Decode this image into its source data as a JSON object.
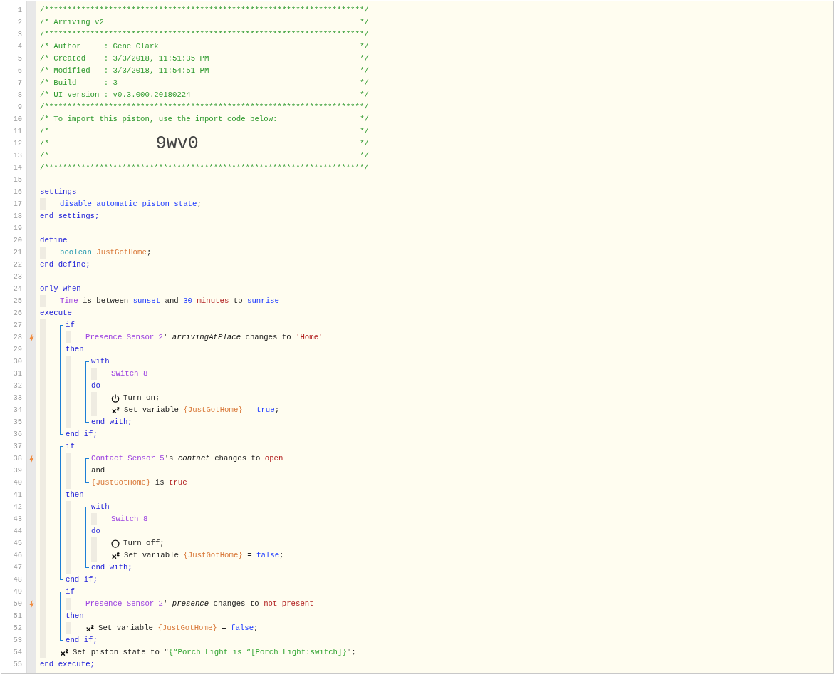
{
  "lines": [
    {
      "kind": "line",
      "number": "1",
      "trigger": false,
      "tokens": [
        {
          "kind": "comment",
          "text": "/**********************************************************************/"
        }
      ]
    },
    {
      "kind": "line",
      "number": "2",
      "trigger": false,
      "tokens": [
        {
          "kind": "comment",
          "text": "/* Arriving v2"
        }
      ],
      "tail": "*/"
    },
    {
      "kind": "line",
      "number": "3",
      "trigger": false,
      "tokens": [
        {
          "kind": "comment",
          "text": "/**********************************************************************/"
        }
      ]
    },
    {
      "kind": "line",
      "number": "4",
      "trigger": false,
      "tokens": [
        {
          "kind": "comment",
          "text": "/* Author     : Gene Clark"
        }
      ],
      "tail": "*/"
    },
    {
      "kind": "line",
      "number": "5",
      "trigger": false,
      "tokens": [
        {
          "kind": "comment",
          "text": "/* Created    : 3/3/2018, 11:51:35 PM"
        }
      ],
      "tail": "*/"
    },
    {
      "kind": "line",
      "number": "6",
      "trigger": false,
      "tokens": [
        {
          "kind": "comment",
          "text": "/* Modified   : 3/3/2018, 11:54:51 PM"
        }
      ],
      "tail": "*/"
    },
    {
      "kind": "line",
      "number": "7",
      "trigger": false,
      "tokens": [
        {
          "kind": "comment",
          "text": "/* Build      : 3"
        }
      ],
      "tail": "*/"
    },
    {
      "kind": "line",
      "number": "8",
      "trigger": false,
      "tokens": [
        {
          "kind": "comment",
          "text": "/* UI version : v0.3.000.20180224"
        }
      ],
      "tail": "*/"
    },
    {
      "kind": "line",
      "number": "9",
      "trigger": false,
      "tokens": [
        {
          "kind": "comment",
          "text": "/**********************************************************************/"
        }
      ]
    },
    {
      "kind": "line",
      "number": "10",
      "trigger": false,
      "tokens": [
        {
          "kind": "comment",
          "text": "/* To import this piston, use the import code below:"
        }
      ],
      "tail": "*/"
    },
    {
      "kind": "line",
      "number": "11",
      "trigger": false,
      "tokens": [
        {
          "kind": "comment",
          "text": "/*"
        }
      ],
      "tail": "*/"
    },
    {
      "kind": "line",
      "number": "12",
      "trigger": false,
      "tokens": [
        {
          "kind": "comment",
          "text": "/*"
        },
        {
          "kind": "code",
          "text": "9wv0"
        }
      ],
      "tail": "*/"
    },
    {
      "kind": "line",
      "number": "13",
      "trigger": false,
      "tokens": [
        {
          "kind": "comment",
          "text": "/*"
        }
      ],
      "tail": "*/"
    },
    {
      "kind": "line",
      "number": "14",
      "trigger": false,
      "tokens": [
        {
          "kind": "comment",
          "text": "/**********************************************************************/"
        }
      ]
    },
    {
      "kind": "line",
      "number": "15",
      "trigger": false
    },
    {
      "kind": "line",
      "number": "16",
      "trigger": false,
      "tokens": [
        {
          "kind": "keyword",
          "text": "settings"
        }
      ],
      "children": [
        {
          "kind": "line",
          "number": "17",
          "trigger": false,
          "tokens": [
            {
              "kind": "literal",
              "text": "disable automatic piston state"
            },
            {
              "kind": "plain",
              "text": ";"
            }
          ]
        }
      ]
    },
    {
      "kind": "line",
      "number": "18",
      "trigger": false,
      "tokens": [
        {
          "kind": "keyword",
          "text": "end settings;"
        }
      ]
    },
    {
      "kind": "line",
      "number": "19",
      "trigger": false
    },
    {
      "kind": "line",
      "number": "20",
      "trigger": false,
      "tokens": [
        {
          "kind": "keyword",
          "text": "define"
        }
      ],
      "children": [
        {
          "kind": "line",
          "number": "21",
          "trigger": false,
          "tokens": [
            {
              "kind": "type",
              "text": "boolean "
            },
            {
              "kind": "variable",
              "text": "JustGotHome"
            },
            {
              "kind": "plain",
              "text": ";"
            }
          ]
        }
      ]
    },
    {
      "kind": "line",
      "number": "22",
      "trigger": false,
      "tokens": [
        {
          "kind": "keyword",
          "text": "end define;"
        }
      ]
    },
    {
      "kind": "line",
      "number": "23",
      "trigger": false
    },
    {
      "kind": "line",
      "number": "24",
      "trigger": false,
      "tokens": [
        {
          "kind": "keyword",
          "text": "only when"
        }
      ],
      "children": [
        {
          "kind": "line",
          "number": "25",
          "trigger": false,
          "tokens": [
            {
              "kind": "device",
              "text": "Time"
            },
            {
              "kind": "plain",
              "text": " is between "
            },
            {
              "kind": "literal",
              "text": "sunset"
            },
            {
              "kind": "plain",
              "text": " and "
            },
            {
              "kind": "literal",
              "text": "30"
            },
            {
              "kind": "value",
              "text": " minutes"
            },
            {
              "kind": "plain",
              "text": " to "
            },
            {
              "kind": "literal",
              "text": "sunrise"
            }
          ]
        }
      ]
    },
    {
      "kind": "line",
      "number": "26",
      "trigger": false,
      "tokens": [
        {
          "kind": "keyword",
          "text": "execute"
        }
      ],
      "children": [
        {
          "kind": "group",
          "items": [
            {
              "kind": "line",
              "number": "27",
              "trigger": false,
              "tokens": [
                {
                  "kind": "keyword",
                  "text": "if"
                }
              ],
              "children": [
                {
                  "kind": "line",
                  "number": "28",
                  "trigger": true,
                  "tokens": [
                    {
                      "kind": "device",
                      "text": "Presence Sensor 2"
                    },
                    {
                      "kind": "plain",
                      "text": "' "
                    },
                    {
                      "kind": "attribute",
                      "text": "arrivingAtPlace"
                    },
                    {
                      "kind": "plain",
                      "text": " changes to "
                    },
                    {
                      "kind": "value",
                      "text": "'Home'"
                    }
                  ]
                }
              ]
            },
            {
              "kind": "line",
              "number": "29",
              "trigger": false,
              "tokens": [
                {
                  "kind": "keyword",
                  "text": "then"
                }
              ],
              "children": [
                {
                  "kind": "group",
                  "items": [
                    {
                      "kind": "line",
                      "number": "30",
                      "trigger": false,
                      "tokens": [
                        {
                          "kind": "keyword",
                          "text": "with"
                        }
                      ],
                      "children": [
                        {
                          "kind": "line",
                          "number": "31",
                          "trigger": false,
                          "tokens": [
                            {
                              "kind": "device",
                              "text": "Switch 8"
                            }
                          ]
                        }
                      ]
                    },
                    {
                      "kind": "line",
                      "number": "32",
                      "trigger": false,
                      "tokens": [
                        {
                          "kind": "keyword",
                          "text": "do"
                        }
                      ],
                      "children": [
                        {
                          "kind": "line",
                          "number": "33",
                          "trigger": false,
                          "tokens": [
                            {
                              "kind": "power"
                            },
                            {
                              "kind": "plain",
                              "text": "Turn on;"
                            }
                          ]
                        },
                        {
                          "kind": "line",
                          "number": "34",
                          "trigger": false,
                          "tokens": [
                            {
                              "kind": "superscript"
                            },
                            {
                              "kind": "plain",
                              "text": "Set variable "
                            },
                            {
                              "kind": "variable",
                              "text": "{JustGotHome}"
                            },
                            {
                              "kind": "plain",
                              "text": " = "
                            },
                            {
                              "kind": "literal",
                              "text": "true"
                            },
                            {
                              "kind": "plain",
                              "text": ";"
                            }
                          ]
                        }
                      ]
                    },
                    {
                      "kind": "line",
                      "number": "35",
                      "trigger": false,
                      "tokens": [
                        {
                          "kind": "keyword",
                          "text": "end with;"
                        }
                      ]
                    }
                  ]
                }
              ]
            },
            {
              "kind": "line",
              "number": "36",
              "trigger": false,
              "tokens": [
                {
                  "kind": "keyword",
                  "text": "end if;"
                }
              ]
            }
          ]
        },
        {
          "kind": "group",
          "items": [
            {
              "kind": "line",
              "number": "37",
              "trigger": false,
              "tokens": [
                {
                  "kind": "keyword",
                  "text": "if"
                }
              ],
              "children": [
                {
                  "kind": "group",
                  "items": [
                    {
                      "kind": "line",
                      "number": "38",
                      "trigger": true,
                      "tokens": [
                        {
                          "kind": "device",
                          "text": "Contact Sensor 5"
                        },
                        {
                          "kind": "plain",
                          "text": "'s "
                        },
                        {
                          "kind": "attribute",
                          "text": "contact"
                        },
                        {
                          "kind": "plain",
                          "text": " changes to "
                        },
                        {
                          "kind": "value",
                          "text": "open"
                        }
                      ]
                    },
                    {
                      "kind": "line",
                      "number": "39",
                      "trigger": false,
                      "tokens": [
                        {
                          "kind": "plain",
                          "text": "and"
                        }
                      ]
                    },
                    {
                      "kind": "line",
                      "number": "40",
                      "trigger": false,
                      "tokens": [
                        {
                          "kind": "variable",
                          "text": "{JustGotHome}"
                        },
                        {
                          "kind": "plain",
                          "text": " is "
                        },
                        {
                          "kind": "value",
                          "text": "true"
                        }
                      ]
                    }
                  ]
                }
              ]
            },
            {
              "kind": "line",
              "number": "41",
              "trigger": false,
              "tokens": [
                {
                  "kind": "keyword",
                  "text": "then"
                }
              ],
              "children": [
                {
                  "kind": "group",
                  "items": [
                    {
                      "kind": "line",
                      "number": "42",
                      "trigger": false,
                      "tokens": [
                        {
                          "kind": "keyword",
                          "text": "with"
                        }
                      ],
                      "children": [
                        {
                          "kind": "line",
                          "number": "43",
                          "trigger": false,
                          "tokens": [
                            {
                              "kind": "device",
                              "text": "Switch 8"
                            }
                          ]
                        }
                      ]
                    },
                    {
                      "kind": "line",
                      "number": "44",
                      "trigger": false,
                      "tokens": [
                        {
                          "kind": "keyword",
                          "text": "do"
                        }
                      ],
                      "children": [
                        {
                          "kind": "line",
                          "number": "45",
                          "trigger": false,
                          "tokens": [
                            {
                              "kind": "ring"
                            },
                            {
                              "kind": "plain",
                              "text": "Turn off;"
                            }
                          ]
                        },
                        {
                          "kind": "line",
                          "number": "46",
                          "trigger": false,
                          "tokens": [
                            {
                              "kind": "superscript"
                            },
                            {
                              "kind": "plain",
                              "text": "Set variable "
                            },
                            {
                              "kind": "variable",
                              "text": "{JustGotHome}"
                            },
                            {
                              "kind": "plain",
                              "text": " = "
                            },
                            {
                              "kind": "literal",
                              "text": "false"
                            },
                            {
                              "kind": "plain",
                              "text": ";"
                            }
                          ]
                        }
                      ]
                    },
                    {
                      "kind": "line",
                      "number": "47",
                      "trigger": false,
                      "tokens": [
                        {
                          "kind": "keyword",
                          "text": "end with;"
                        }
                      ]
                    }
                  ]
                }
              ]
            },
            {
              "kind": "line",
              "number": "48",
              "trigger": false,
              "tokens": [
                {
                  "kind": "keyword",
                  "text": "end if;"
                }
              ]
            }
          ]
        },
        {
          "kind": "group",
          "items": [
            {
              "kind": "line",
              "number": "49",
              "trigger": false,
              "tokens": [
                {
                  "kind": "keyword",
                  "text": "if"
                }
              ],
              "children": [
                {
                  "kind": "line",
                  "number": "50",
                  "trigger": true,
                  "tokens": [
                    {
                      "kind": "device",
                      "text": "Presence Sensor 2"
                    },
                    {
                      "kind": "plain",
                      "text": "' "
                    },
                    {
                      "kind": "attribute",
                      "text": "presence"
                    },
                    {
                      "kind": "plain",
                      "text": " changes to "
                    },
                    {
                      "kind": "value",
                      "text": "not present"
                    }
                  ]
                }
              ]
            },
            {
              "kind": "line",
              "number": "51",
              "trigger": false,
              "tokens": [
                {
                  "kind": "keyword",
                  "text": "then"
                }
              ],
              "children": [
                {
                  "kind": "line",
                  "number": "52",
                  "trigger": false,
                  "tokens": [
                    {
                      "kind": "superscript"
                    },
                    {
                      "kind": "plain",
                      "text": "Set variable "
                    },
                    {
                      "kind": "variable",
                      "text": "{JustGotHome}"
                    },
                    {
                      "kind": "plain",
                      "text": " = "
                    },
                    {
                      "kind": "literal",
                      "text": "false"
                    },
                    {
                      "kind": "plain",
                      "text": ";"
                    }
                  ]
                }
              ]
            },
            {
              "kind": "line",
              "number": "53",
              "trigger": false,
              "tokens": [
                {
                  "kind": "keyword",
                  "text": "end if;"
                }
              ]
            }
          ]
        },
        {
          "kind": "line",
          "number": "54",
          "trigger": false,
          "tokens": [
            {
              "kind": "superscript"
            },
            {
              "kind": "plain",
              "text": "Set piston state to \""
            },
            {
              "kind": "string",
              "text": "{“Porch Light is “[Porch Light:switch]}"
            },
            {
              "kind": "plain",
              "text": "\";"
            }
          ]
        }
      ]
    },
    {
      "kind": "line",
      "number": "55",
      "trigger": false,
      "tokens": [
        {
          "kind": "keyword",
          "text": "end execute;"
        }
      ]
    }
  ]
}
